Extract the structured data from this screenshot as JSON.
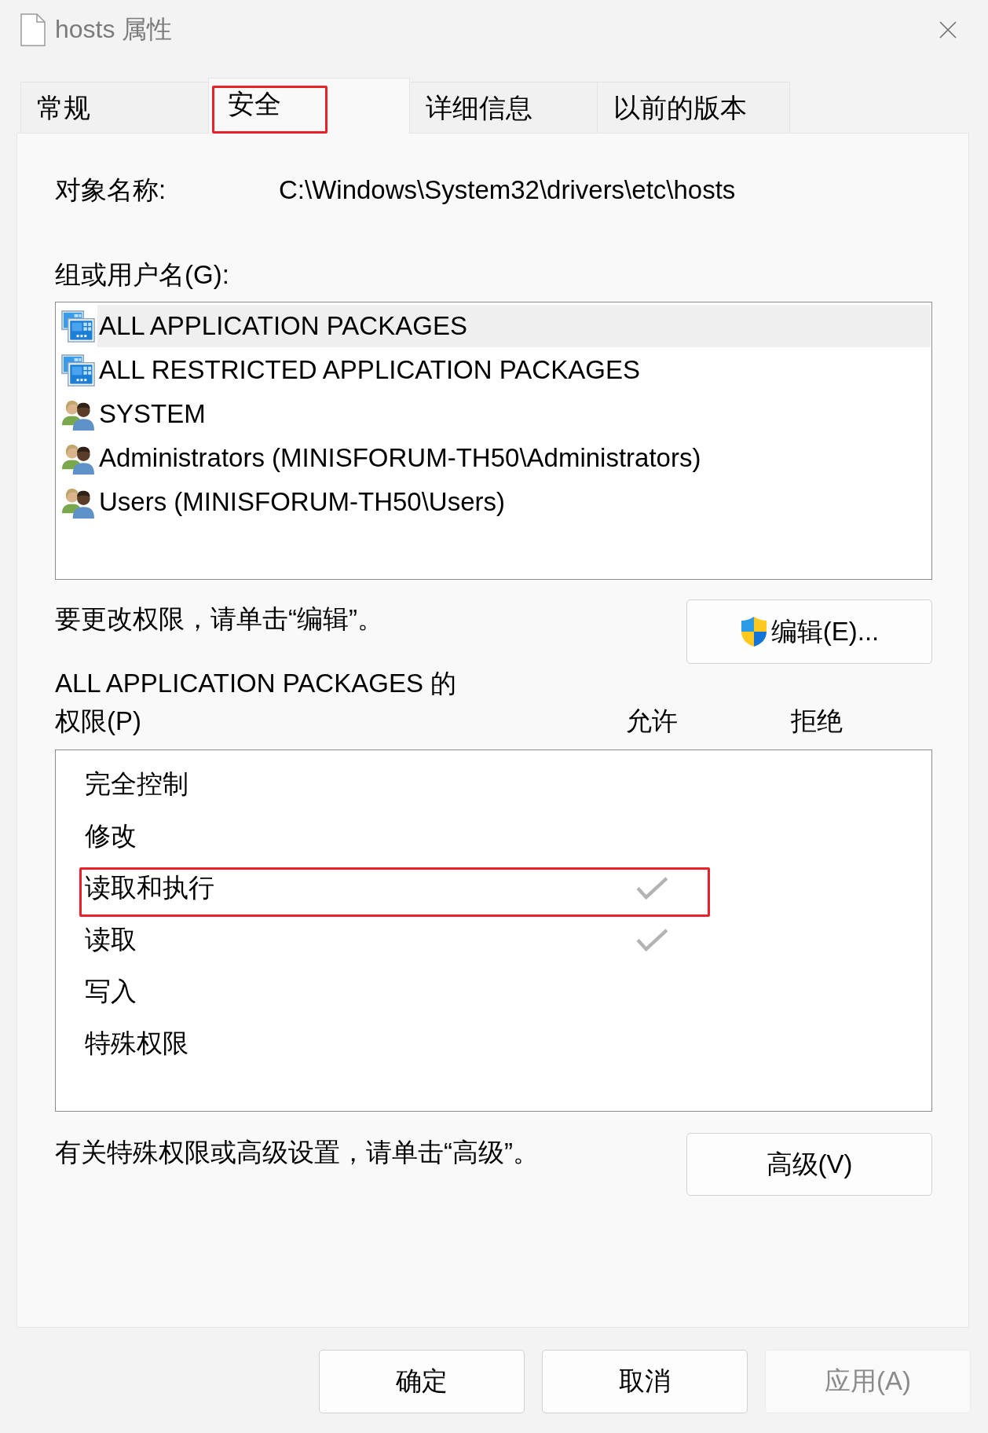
{
  "window": {
    "title": "hosts 属性"
  },
  "tabs": [
    {
      "label": "常规",
      "selected": false,
      "marked": false
    },
    {
      "label": "安全",
      "selected": true,
      "marked": true
    },
    {
      "label": "详细信息",
      "selected": false,
      "marked": false
    },
    {
      "label": "以前的版本",
      "selected": false,
      "marked": false
    }
  ],
  "object_name": {
    "label": "对象名称:",
    "value": "C:\\Windows\\System32\\drivers\\etc\\hosts"
  },
  "groups": {
    "label": "组或用户名(G):",
    "items": [
      {
        "name": "ALL APPLICATION PACKAGES",
        "kind": "package",
        "selected": true
      },
      {
        "name": "ALL RESTRICTED APPLICATION PACKAGES",
        "kind": "package",
        "selected": false
      },
      {
        "name": "SYSTEM",
        "kind": "group",
        "selected": false
      },
      {
        "name": "Administrators (MINISFORUM-TH50\\Administrators)",
        "kind": "group",
        "selected": false
      },
      {
        "name": "Users (MINISFORUM-TH50\\Users)",
        "kind": "group",
        "selected": false
      }
    ]
  },
  "edit": {
    "hint": "要更改权限，请单击“编辑”。",
    "button": "编辑(E)..."
  },
  "permissions": {
    "title": "ALL APPLICATION PACKAGES 的",
    "label": "权限(P)",
    "allow_header": "允许",
    "deny_header": "拒绝",
    "items": [
      {
        "name": "完全控制",
        "allow": false,
        "deny": false,
        "marked": false
      },
      {
        "name": "修改",
        "allow": false,
        "deny": false,
        "marked": false
      },
      {
        "name": "读取和执行",
        "allow": true,
        "deny": false,
        "marked": true
      },
      {
        "name": "读取",
        "allow": true,
        "deny": false,
        "marked": false
      },
      {
        "name": "写入",
        "allow": false,
        "deny": false,
        "marked": false
      },
      {
        "name": "特殊权限",
        "allow": false,
        "deny": false,
        "marked": false
      }
    ]
  },
  "advanced": {
    "hint": "有关特殊权限或高级设置，请单击“高级”。",
    "button": "高级(V)"
  },
  "buttons": [
    {
      "label": "确定",
      "disabled": false
    },
    {
      "label": "取消",
      "disabled": false
    },
    {
      "label": "应用(A)",
      "disabled": true
    }
  ]
}
